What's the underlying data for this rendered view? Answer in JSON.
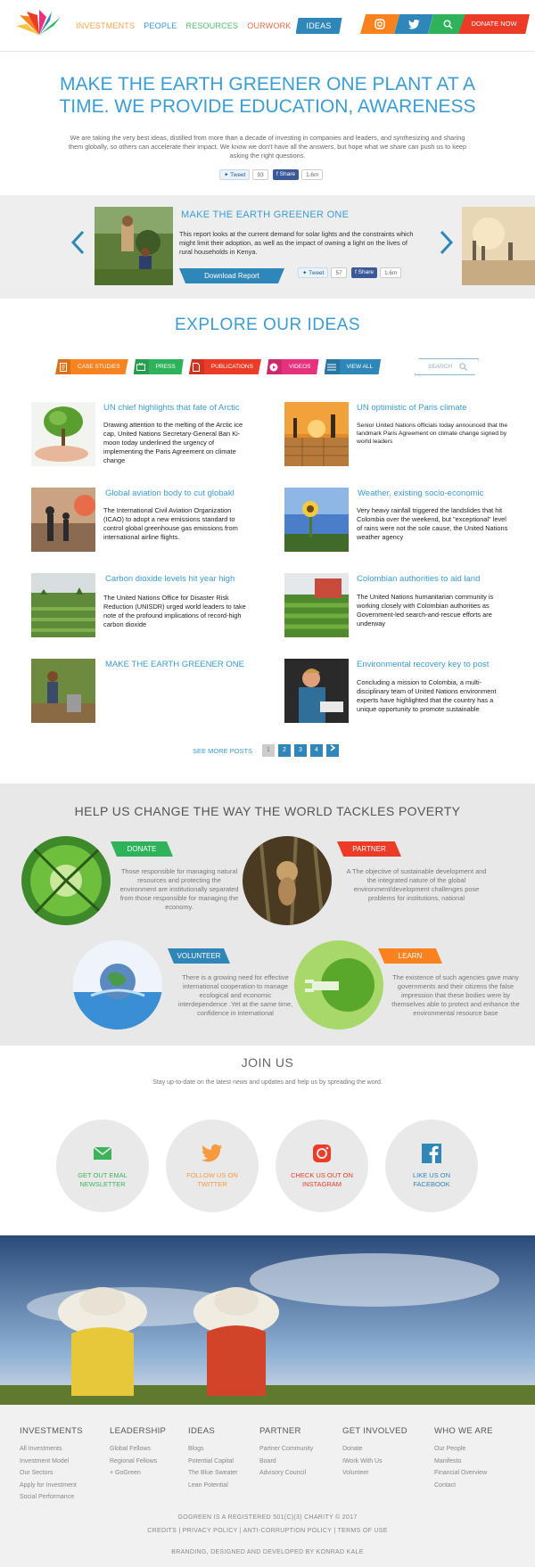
{
  "nav": {
    "items": [
      "INVESTMENTS",
      "PEOPLE",
      "RESOURCES",
      "OURWORK",
      "IDEAS"
    ],
    "donate_label": "DONATE NOW",
    "icons": [
      "instagram-icon",
      "twitter-icon",
      "search-icon"
    ]
  },
  "hero": {
    "title": "MAKE THE EARTH GREENER ONE PLANT AT A TIME. WE PROVIDE EDUCATION, AWARENESS",
    "text": "We are taking the very best ideas, distilled from more than a decade of investing in companies and leaders, and synthesizing and sharing them globally, so others can accelerate their impact. We know we don't have all the answers, but hope what we share can push us to keep asking the right questions.",
    "tweet_label": "Tweet",
    "tweet_count": "93",
    "share_label": "Share",
    "share_count": "1.6m"
  },
  "slider": {
    "title": "MAKE THE EARTH GREENER ONE",
    "text": "This report looks at the current demand for solar lights and the constraints which might limit their adoption, as well as the impact of owning a light on the lives of rural households in Kenya.",
    "download_label": "Download Report",
    "tweet_label": "Tweet",
    "tweet_count": "57",
    "share_label": "Share",
    "share_count": "1.6m"
  },
  "explore": {
    "title": "EXPLORE OUR IDEAS",
    "filters": [
      "CASE STUDIES",
      "PRESS",
      "PUBLICATIONS",
      "VIDEOS",
      "VIEW ALL"
    ],
    "search_placeholder": "SEARCH",
    "posts": [
      {
        "title": "UN chief highlights that fate of Arctic",
        "text": "Drawing attention to the melting of the Arctic ice cap, United Nations Secretary-General Ban Ki-moon today underlined the urgency of implementing the Paris Agreement on climate change"
      },
      {
        "title": "UN optimistic of Paris climate",
        "text": "Senior United Nations officials today announced that the landmark Paris Agreement on climate change signed by world leaders"
      },
      {
        "title": "Global aviation body to cut globakl",
        "text": "The International Civil Aviation Organization (ICAO) to adopt a new emissions standard to control global greenhouse gas emissions from international airline flights."
      },
      {
        "title": "Weather, existing socio-economic",
        "text": "Very heavy rainfall triggered the landslides that hit Colombia over the weekend, but \"exceptional\" level of rains were not the sole cause, the United Nations weather agency"
      },
      {
        "title": "Carbon dioxide levels hit  year high",
        "text": "The United Nations Office for Disaster Risk Reduction (UNISDR) urged world leaders to take note of the profound implications of record-high carbon dioxide"
      },
      {
        "title": "Colombian authorities to aid land",
        "text": "The United Nations humanitarian community is working closely with Colombian authorities as Government-led search-and-rescue efforts are underway"
      },
      {
        "title": "MAKE THE EARTH GREENER ONE",
        "text": ""
      },
      {
        "title": "Environmental recovery key to post",
        "text": "Concluding a mission to Colombia, a multi-disciplinary team of United Nations environment experts have highlighted that the country has a unique opportunity to promote sustainable"
      }
    ],
    "see_more_label": "SEE MORE POSTS",
    "pages": [
      "1",
      "2",
      "3",
      "4"
    ],
    "current_page": 1
  },
  "help": {
    "title": "HELP US CHANGE THE WAY THE WORLD TACKLES POVERTY",
    "cards": [
      {
        "label": "DONATE",
        "text": "Those responsible for managing natural resources and protecting the environment are institutionally separated from those responsible for managing the economy."
      },
      {
        "label": "PARTNER",
        "text": "A The objective of sustainable development and the integrated nature of the global environment/development challenges pose problems for institutions, national"
      },
      {
        "label": "VOLUNTEER",
        "text": "There is a growing need for effective international cooperation to manage ecological and economic interdependence .Yet at the same time, confidence in international"
      },
      {
        "label": "LEARN",
        "text": "The existence of such agencies gave many governments and their citizens the false impression that these bodies were by themselves able to protect and enhance the environmental resource base"
      }
    ]
  },
  "join": {
    "title": "JOIN US",
    "subtitle": "Stay up-to-date on the latest news and updates and help us by spreading the word.",
    "items": [
      {
        "label": "GET OUT EMAL NEWSLETTER",
        "icon": "envelope-icon",
        "color": "#3cb55a"
      },
      {
        "label": "FOLLOW US ON TWITTER",
        "icon": "twitter-icon",
        "color": "#f79a3e"
      },
      {
        "label": "CHECK US OUT ON INSTAGRAM",
        "icon": "instagram-icon",
        "color": "#ec3b26"
      },
      {
        "label": "LIKE US ON FACEBOOK",
        "icon": "facebook-icon",
        "color": "#2e87b8"
      }
    ]
  },
  "footer": {
    "columns": [
      {
        "title": "INVESTMENTS",
        "links": [
          "All Investments",
          "Investment Model",
          "Our Sectors",
          "Apply for Investment",
          "Social Performance"
        ]
      },
      {
        "title": "LEADERSHIP",
        "links": [
          "Global Fellows",
          "Regional Fellows",
          "+ GoGreen"
        ]
      },
      {
        "title": "IDEAS",
        "links": [
          "Blogs",
          "Potential Capital",
          "The Blue Sweater",
          "Lean Potential"
        ]
      },
      {
        "title": "PARTNER",
        "links": [
          "Partner Community",
          "Board",
          "Advisory Council"
        ]
      },
      {
        "title": "GET INVOLVED",
        "links": [
          "Donate",
          "IWork With Us",
          "Volunteer"
        ]
      },
      {
        "title": "WHO WE ARE",
        "links": [
          "Our People",
          "Manifesto",
          "Financial Overview",
          "Contact"
        ]
      }
    ],
    "charity": "GOGREEN IS A REGISTERED 501(C)(3) CHARITY © 2017",
    "links": "CREDITS | PRIVACY POLICY | ANTI-CORRUPTION POLICY | TERMS OF USE",
    "credit": "BRANDING, DESIGNED AND DEVELOPED BY KONRAD KALE"
  },
  "colors": {
    "blue": "#2e87b8",
    "title_blue": "#3a9dd4",
    "orange": "#f7821e",
    "green": "#2fb35a",
    "red": "#ec3b26",
    "pink": "#e8317c"
  }
}
